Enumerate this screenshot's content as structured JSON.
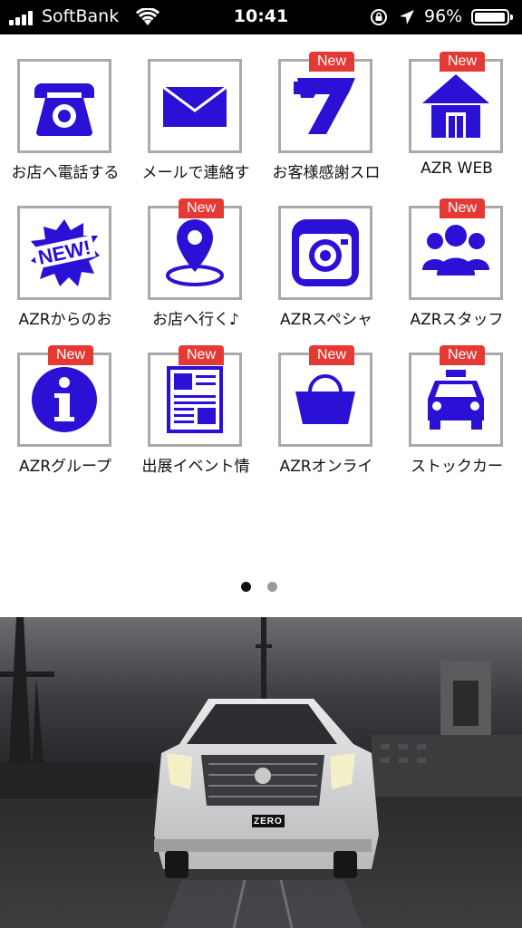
{
  "status_bar": {
    "carrier": "SoftBank",
    "time": "10:41",
    "battery": "96%",
    "icons": [
      "signal-icon",
      "wifi-icon",
      "rotation-lock-icon",
      "location-icon",
      "battery-icon"
    ]
  },
  "new_badge": "New",
  "colors": {
    "icon": "#2b10d6",
    "badge": "#e53935",
    "tile_border": "#aaaaaa"
  },
  "tiles": [
    {
      "label": "お店へ電話する",
      "icon": "telephone-icon",
      "new": false
    },
    {
      "label": "メールで連絡す",
      "icon": "mail-icon",
      "new": false
    },
    {
      "label": "お客様感謝スロ",
      "icon": "slot-seven-icon",
      "new": true
    },
    {
      "label": "AZR WEB",
      "icon": "house-icon",
      "new": true
    },
    {
      "label": "AZRからのお",
      "icon": "new-starburst-icon",
      "new": false
    },
    {
      "label": "お店へ行く♪",
      "icon": "map-pin-icon",
      "new": true
    },
    {
      "label": "AZRスペシャ",
      "icon": "camera-icon",
      "new": false
    },
    {
      "label": "AZRスタッフ",
      "icon": "people-icon",
      "new": true
    },
    {
      "label": "AZRグループ",
      "icon": "info-icon",
      "new": true
    },
    {
      "label": "出展イベント情",
      "icon": "newspaper-icon",
      "new": true
    },
    {
      "label": "AZRオンライ",
      "icon": "shopping-basket-icon",
      "new": true
    },
    {
      "label": "ストックカー",
      "icon": "car-icon",
      "new": true
    }
  ],
  "pager": {
    "pages": 2,
    "current": 1
  },
  "banner": {
    "description_icon": "car-photo-banner",
    "plate": "ZERO"
  }
}
